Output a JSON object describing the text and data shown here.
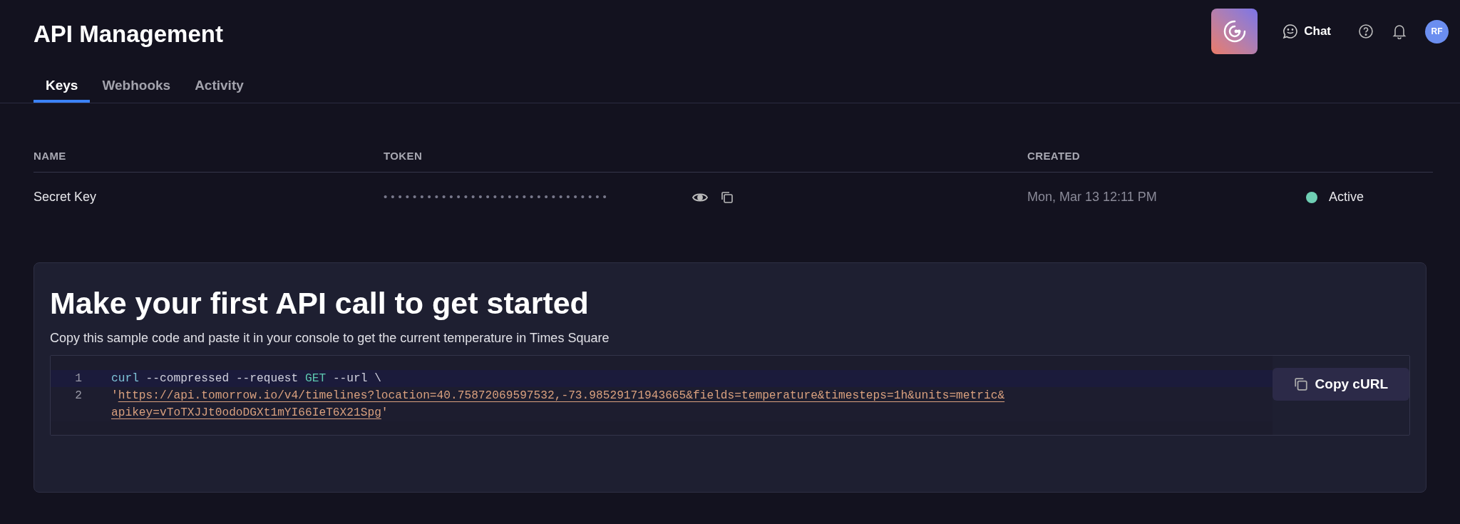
{
  "page": {
    "title": "API Management"
  },
  "header": {
    "chat_label": "Chat",
    "avatar_initials": "RF"
  },
  "tabs": [
    {
      "label": "Keys",
      "selected": true
    },
    {
      "label": "Webhooks",
      "selected": false
    },
    {
      "label": "Activity",
      "selected": false
    }
  ],
  "table": {
    "columns": [
      "NAME",
      "TOKEN",
      "CREATED"
    ],
    "rows": [
      {
        "name": "Secret Key",
        "token": "•••••••••••••••••••••••••••••••",
        "created": "Mon, Mar 13 12:11 PM",
        "status": "Active",
        "color": "#6fcfb4"
      }
    ]
  },
  "getting_started": {
    "title": "Make your first API call to get started",
    "description": "Copy this sample code and paste it in your console to get the current temperature in Times Square",
    "code_lines": [
      {
        "number": "1",
        "highlighted": true,
        "tokens": [
          {
            "kind": "command",
            "text": "curl"
          },
          {
            "kind": "flag",
            "text": "--compressed"
          },
          {
            "kind": "flag",
            "text": "--request"
          },
          {
            "kind": "method",
            "text": "GET"
          },
          {
            "kind": "flag",
            "text": "--url"
          },
          {
            "kind": "plain",
            "text": "\\"
          }
        ]
      },
      {
        "number": "2",
        "highlighted": false,
        "tokens": [
          {
            "kind": "quote",
            "text": "'"
          },
          {
            "kind": "link",
            "text": "https://api.tomorrow.io/v4/timelines?location=40.75872069597532,-73.98529171943665&fields=temperature&timesteps=1h&units=metric&apikey=vToTXJJt0odoDGXt1mYI66IeT6X21Spg"
          },
          {
            "kind": "quote",
            "text": "'"
          }
        ]
      }
    ],
    "copy_button": "Copy cURL"
  }
}
